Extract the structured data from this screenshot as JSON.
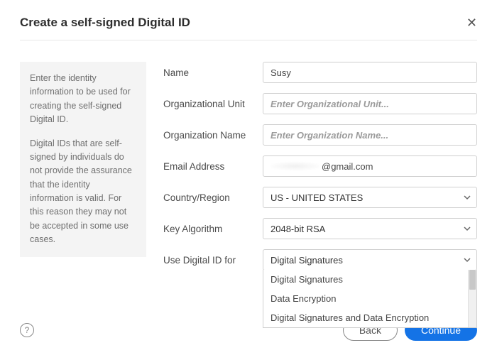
{
  "dialog": {
    "title": "Create a self-signed Digital ID"
  },
  "info": {
    "p1": "Enter the identity information to be used for creating the self-signed Digital ID.",
    "p2": "Digital IDs that are self-signed by individuals do not provide the assurance that the identity information is valid. For this reason they may not be accepted in some use cases."
  },
  "form": {
    "name_label": "Name",
    "name_value": "Susy",
    "org_unit_label": "Organizational Unit",
    "org_unit_placeholder": "Enter Organizational Unit...",
    "org_name_label": "Organization Name",
    "org_name_placeholder": "Enter Organization Name...",
    "email_label": "Email Address",
    "email_suffix": "@gmail.com",
    "country_label": "Country/Region",
    "country_value": "US - UNITED STATES",
    "key_algo_label": "Key Algorithm",
    "key_algo_value": "2048-bit RSA",
    "use_for_label": "Use Digital ID for",
    "use_for_value": "Digital Signatures",
    "use_for_options": {
      "o1": "Digital Signatures",
      "o2": "Data Encryption",
      "o3": "Digital Signatures and Data Encryption"
    }
  },
  "footer": {
    "back": "Back",
    "continue": "Continue"
  }
}
